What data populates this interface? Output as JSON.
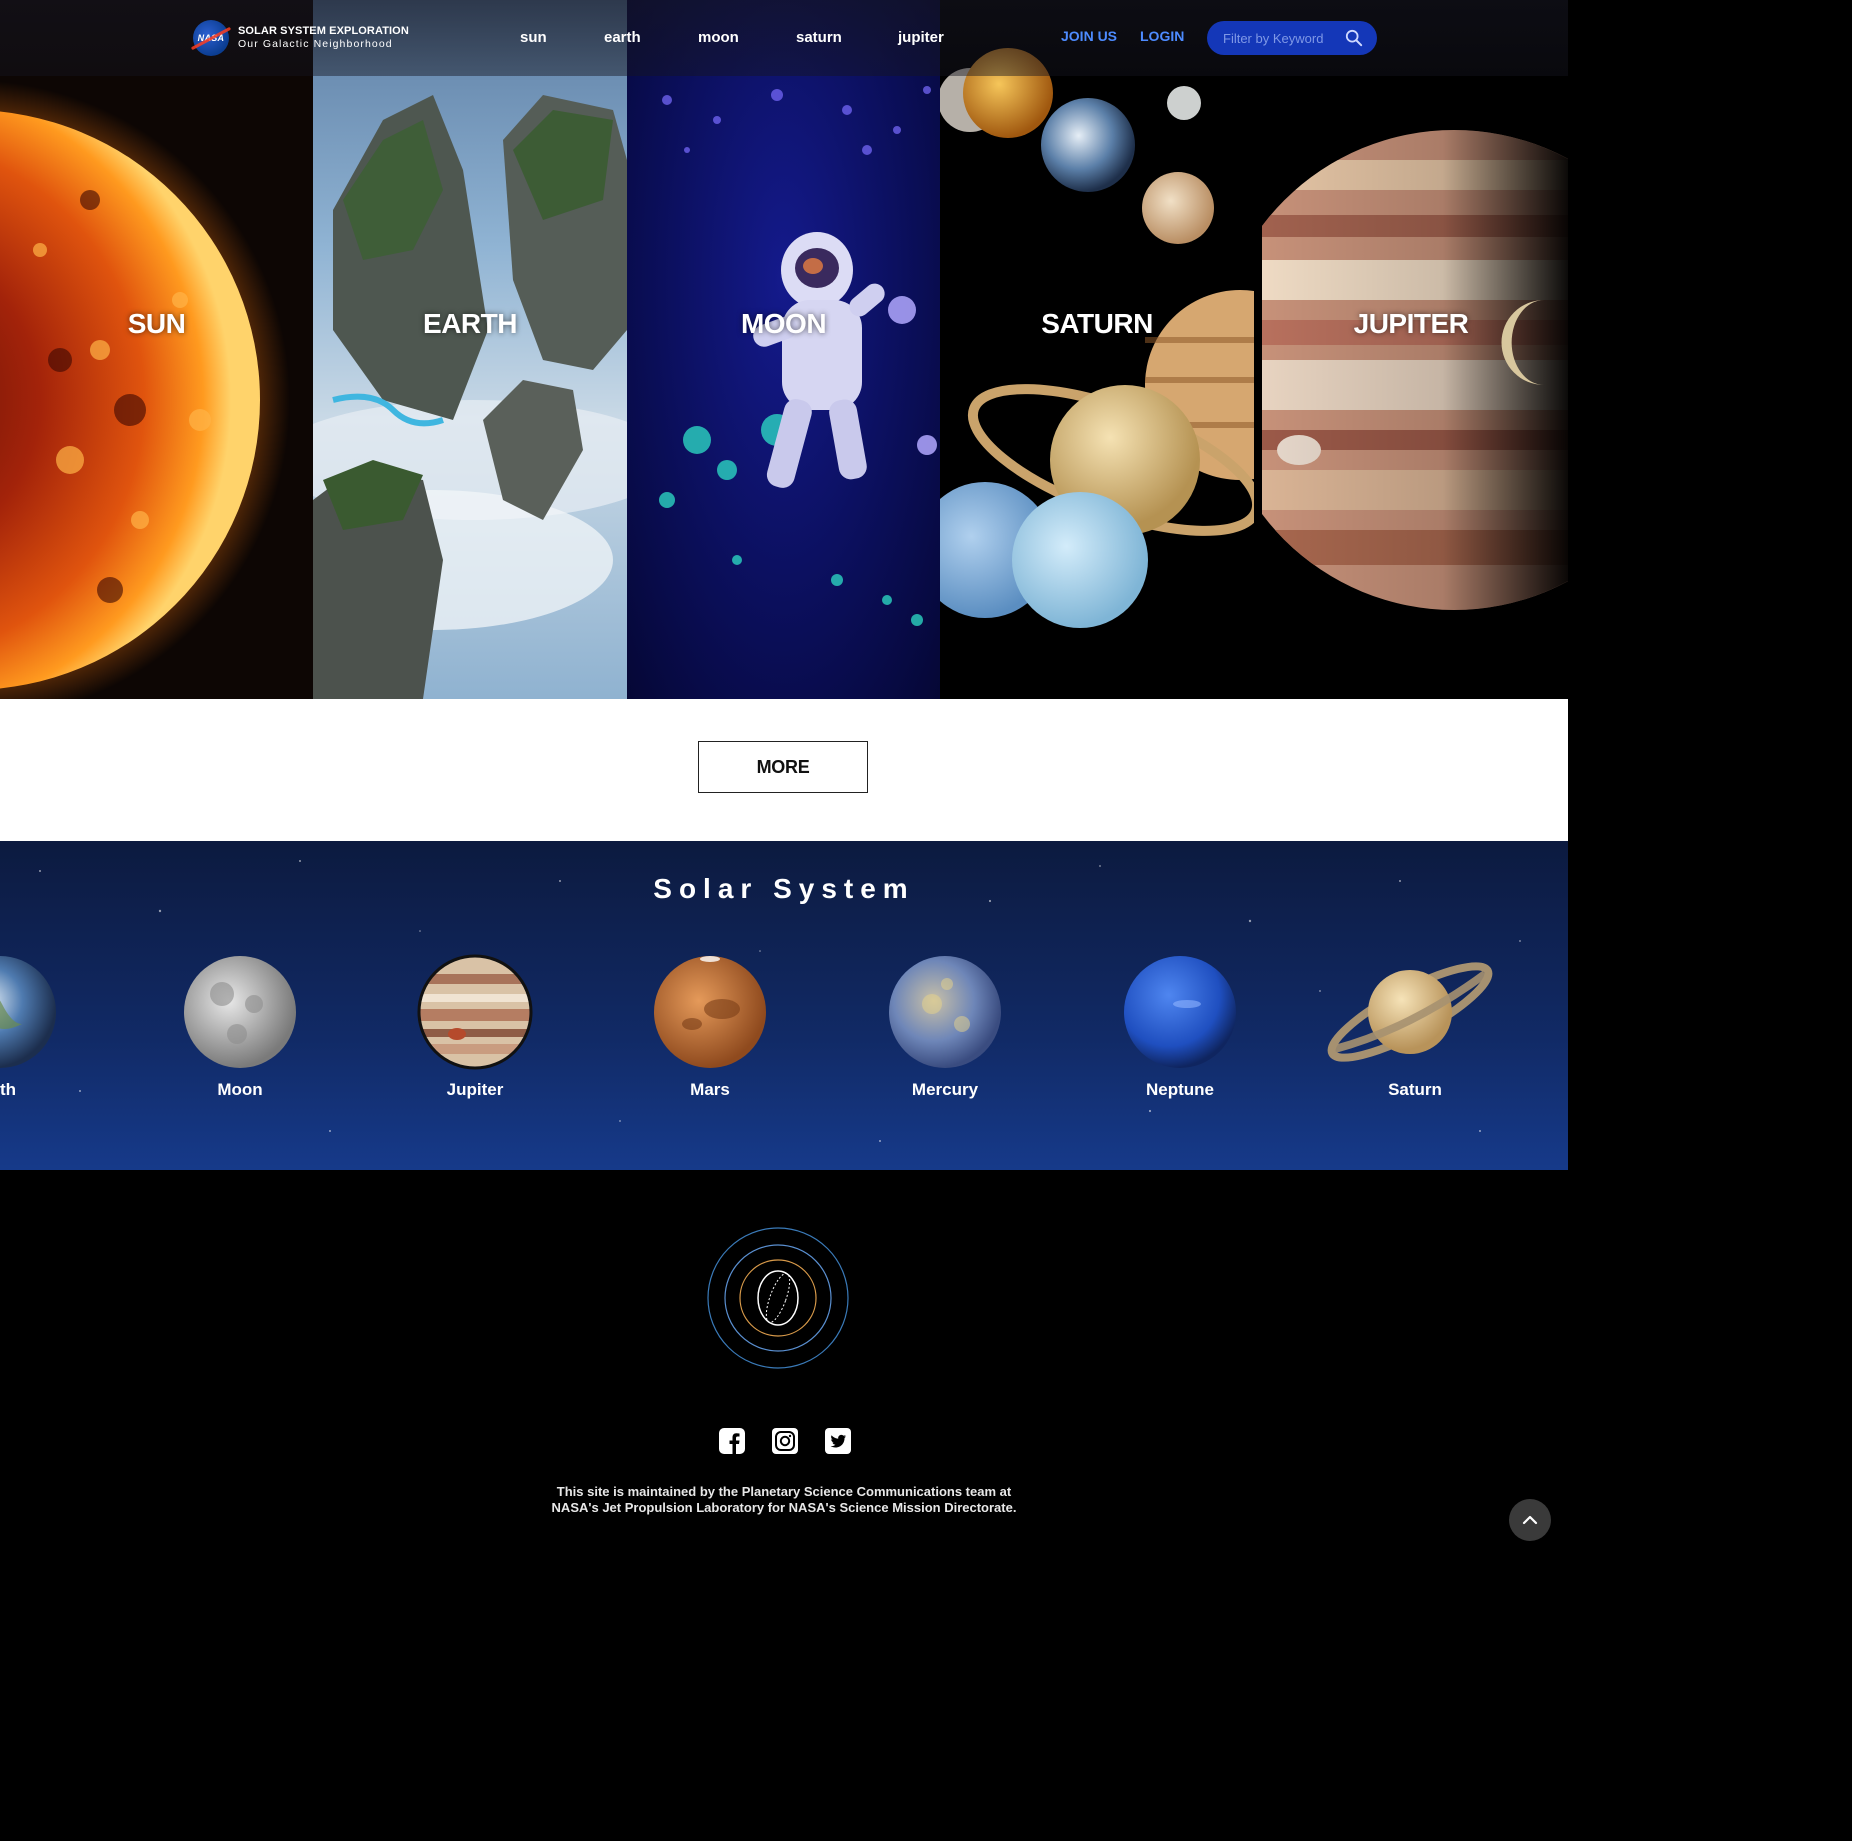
{
  "header": {
    "logo_badge": "NASA",
    "logo_title": "SOLAR SYSTEM EXPLORATION",
    "logo_subtitle": "Our Galactic Neighborhood",
    "nav": [
      "sun",
      "earth",
      "moon",
      "saturn",
      "jupiter"
    ],
    "join_label": "JOIN US",
    "login_label": "LOGIN",
    "search_placeholder": "Filter by Keyword",
    "search_icon": "search-icon",
    "link_color": "#4d8bff",
    "search_bg": "#1437b8"
  },
  "hero": {
    "panels": [
      "SUN",
      "EARTH",
      "MOON",
      "SATURN",
      "JUPITER"
    ]
  },
  "more": {
    "label": "MORE"
  },
  "solar_system": {
    "title": "Solar System",
    "planets": [
      "arth",
      "Moon",
      "Jupiter",
      "Mars",
      "Mercury",
      "Neptune",
      "Saturn"
    ]
  },
  "footer": {
    "socials": [
      "facebook-icon",
      "instagram-icon",
      "twitter-icon"
    ],
    "line1": "This site is maintained by the Planetary Science Communications team at",
    "line2": "NASA's Jet Propulsion Laboratory for NASA's Science Mission Directorate.",
    "back_to_top_icon": "chevron-up-icon"
  }
}
